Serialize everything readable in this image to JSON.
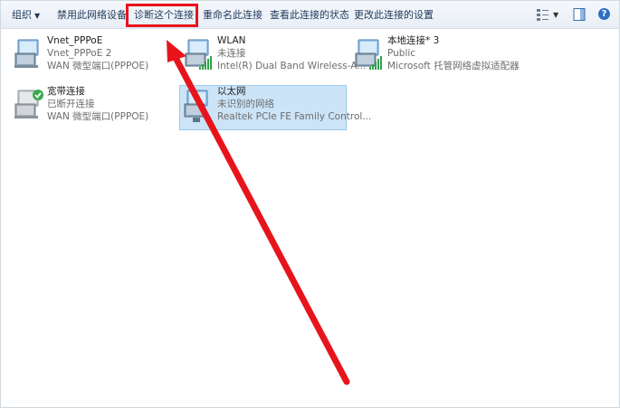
{
  "toolbar": {
    "organize": "组织",
    "disable": "禁用此网络设备",
    "diagnose": "诊断这个连接",
    "rename": "重命名此连接",
    "status": "查看此连接的状态",
    "settings": "更改此连接的设置"
  },
  "connections": [
    {
      "name": "Vnet_PPPoE",
      "status": "Vnet_PPPoE  2",
      "device": "WAN 微型端口(PPPOE)"
    },
    {
      "name": "WLAN",
      "status": "未连接",
      "device": "Intel(R) Dual Band Wireless-A..."
    },
    {
      "name": "本地连接* 3",
      "status": "Public",
      "device": "Microsoft 托管网络虚拟适配器"
    },
    {
      "name": "宽带连接",
      "status": "已断开连接",
      "device": "WAN 微型端口(PPPOE)"
    },
    {
      "name": "以太网",
      "status": "未识别的网络",
      "device": "Realtek PCIe FE Family Control..."
    }
  ],
  "colors": {
    "highlight": "#e8141c",
    "arrow": "#e8141c",
    "selected_bg": "#cce4f7"
  }
}
